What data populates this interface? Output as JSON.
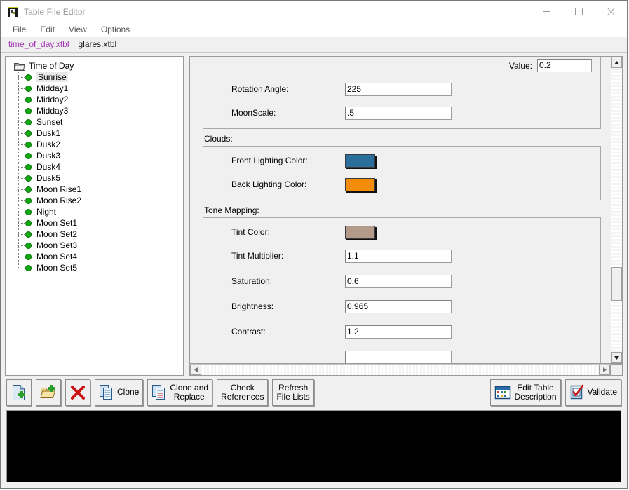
{
  "window": {
    "title": "Table File Editor",
    "icon": "table-file-editor-icon",
    "minimize_label": "—",
    "maximize_label": "□",
    "close_label": "✕"
  },
  "menubar": {
    "items": [
      {
        "label": "File"
      },
      {
        "label": "Edit"
      },
      {
        "label": "View"
      },
      {
        "label": "Options"
      }
    ]
  },
  "tabs": [
    {
      "label": "time_of_day.xtbl",
      "active": true,
      "color": "#a033b0"
    },
    {
      "label": "glares.xtbl",
      "active": false,
      "color": "#1a1a1a"
    }
  ],
  "tree": {
    "root_label": "Time of Day",
    "root_icon": "folder-icon",
    "selected": "Sunrise",
    "nodes": [
      {
        "label": "Sunrise"
      },
      {
        "label": "Midday1"
      },
      {
        "label": "Midday2"
      },
      {
        "label": "Midday3"
      },
      {
        "label": "Sunset"
      },
      {
        "label": "Dusk1"
      },
      {
        "label": "Dusk2"
      },
      {
        "label": "Dusk3"
      },
      {
        "label": "Dusk4"
      },
      {
        "label": "Dusk5"
      },
      {
        "label": "Moon Rise1"
      },
      {
        "label": "Moon Rise2"
      },
      {
        "label": "Night"
      },
      {
        "label": "Moon Set1"
      },
      {
        "label": "Moon Set2"
      },
      {
        "label": "Moon Set3"
      },
      {
        "label": "Moon Set4"
      },
      {
        "label": "Moon Set5"
      }
    ]
  },
  "editor": {
    "top_group": {
      "value_label": "Value:",
      "value_field": "0.2",
      "rows": [
        {
          "label": "Rotation Angle:",
          "value": "225"
        },
        {
          "label": "MoonScale:",
          "value": ".5"
        }
      ]
    },
    "clouds": {
      "group_label": "Clouds:",
      "rows": [
        {
          "label": "Front Lighting Color:",
          "color": "#2a6e9b"
        },
        {
          "label": "Back Lighting Color:",
          "color": "#f28c0a"
        }
      ]
    },
    "tone_mapping": {
      "group_label": "Tone Mapping:",
      "tint_color_label": "Tint Color:",
      "tint_color": "#b39b8b",
      "rows": [
        {
          "label": "Tint Multiplier:",
          "value": "1.1"
        },
        {
          "label": "Saturation:",
          "value": "0.6"
        },
        {
          "label": "Brightness:",
          "value": "0.965"
        },
        {
          "label": "Contrast:",
          "value": "1.2"
        }
      ]
    }
  },
  "scrollbars": {
    "vertical": {
      "up_arrow": "▲",
      "down_arrow": "▼"
    },
    "horizontal": {
      "left_arrow": "◀",
      "right_arrow": "▶"
    }
  },
  "toolbar": {
    "buttons": [
      {
        "name": "new-file-button",
        "icon": "new-file-icon",
        "label": ""
      },
      {
        "name": "open-file-button",
        "icon": "open-folder-icon",
        "label": ""
      },
      {
        "name": "delete-button",
        "icon": "red-x-icon",
        "label": ""
      },
      {
        "name": "clone-button",
        "icon": "copy-icon",
        "label": "Clone"
      },
      {
        "name": "clone-and-replace-button",
        "icon": "copy-replace-icon",
        "label": "Clone and\nReplace"
      },
      {
        "name": "check-references-button",
        "icon": "",
        "label": "Check\nReferences"
      },
      {
        "name": "refresh-file-lists-button",
        "icon": "",
        "label": "Refresh\nFile Lists"
      },
      {
        "name": "edit-table-description-button",
        "icon": "table-grid-icon",
        "label": "Edit Table\nDescription"
      },
      {
        "name": "validate-button",
        "icon": "checkmark-document-icon",
        "label": "Validate"
      }
    ]
  },
  "console": {
    "text": ""
  }
}
